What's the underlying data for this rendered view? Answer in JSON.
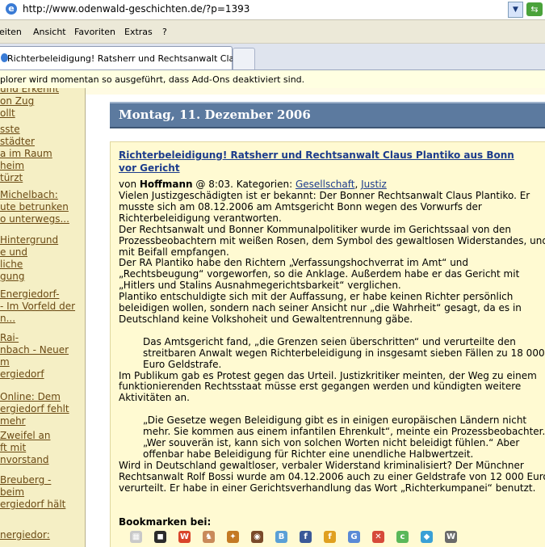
{
  "browser": {
    "address_url": "http://www.odenwald-geschichten.de/?p=1393",
    "menu": [
      "eiten",
      "Ansicht",
      "Favoriten",
      "Extras",
      "?"
    ],
    "tab_title": "Richterbeleidigung! Ratsherr und Rechtsanwalt Claus ...",
    "infobar_text": "plorer wird momentan so ausgeführt, dass Add-Ons deaktiviert sind."
  },
  "sidebar": {
    "items": [
      [
        "und Erkennt",
        "on Zug",
        "ollt"
      ],
      [
        "sste",
        "städter",
        "a im Raum",
        "heim",
        "türzt"
      ],
      [
        "Michelbach:",
        "ute betrunken",
        "o unterwegs..."
      ],
      [
        "Hintergrund",
        "e und",
        "liche",
        "gung"
      ],
      [
        "Energiedorf-",
        "- Im Vorfeld der",
        "n..."
      ],
      [
        "Rai-",
        "nbach - Neuer",
        "m",
        "ergiedorf"
      ],
      [
        "Online: Dem",
        "ergiedorf fehlt",
        "mehr"
      ],
      [
        "Zweifel an",
        "ft mit",
        "nvorstand"
      ],
      [
        "Breuberg -",
        "beim",
        "ergiedorf hält"
      ],
      [
        "nergiedor:"
      ]
    ]
  },
  "main": {
    "date_header": "Montag, 11. Dezember 2006",
    "post": {
      "title": "Richterbeleidigung! Ratsherr und Rechtsanwalt Claus Plantiko aus Bonn vor Gericht",
      "meta_prefix": "von ",
      "author": "Hoffmann",
      "meta_mid": " @ 8:03. Kategorien: ",
      "category_1": "Gesellschaft",
      "category_sep": ", ",
      "category_2": "Justiz",
      "paragraphs": [
        "Vielen Justizgeschädigten ist er bekannt: Der Bonner Rechtsanwalt Claus Plantiko. Er musste sich am 08.12.2006 am Amtsgericht Bonn wegen des Vorwurfs der Richterbeleidigung verantworten.",
        "Der Rechtsanwalt und Bonner Kommunalpolitiker wurde im Gerichtssaal von den Prozessbeobachtern mit weißen Rosen, dem Symbol des gewaltlosen Widerstandes, und mit Beifall empfangen.",
        "Der RA Plantiko habe den Richtern „Verfassungshochverrat im Amt“ und „Rechtsbeugung“ vorgeworfen, so die Anklage. Außerdem habe er das Gericht mit „Hitlers und Stalins Ausnahmegerichtsbarkeit“ verglichen.",
        "Plantiko entschuldigte sich mit der Auffassung, er habe keinen Richter persönlich beleidigen wollen, sondern nach seiner Ansicht nur „die Wahrheit“ gesagt, da es in Deutschland keine Volkshoheit und Gewaltentrennung gäbe.",
        "",
        "Das Amtsgericht fand, „die Grenzen seien überschritten“ und verurteilte den streitbaren Anwalt wegen Richterbeleidigung in insgesamt sieben Fällen zu 18 000 Euro Geldstrafe.",
        "Im Publikum gab es Protest gegen das Urteil. Justizkritiker meinten, der Weg zu einem funktionierenden Rechtsstaat müsse erst gegangen werden und kündigten weitere Aktivitäten an.",
        "",
        "„Die Gesetze wegen Beleidigung gibt es in einigen europäischen Ländern nicht mehr. Sie kommen aus einem infantilen Ehrenkult“, meinte ein Prozessbeobachter. „Wer souverän ist, kann sich von solchen Worten nicht beleidigt fühlen.“ Aber offenbar habe Beleidigung für Richter eine unendliche Halbwertzeit.",
        "Wird in Deutschland gewaltloser, verbaler Widerstand kriminalisiert? Der Münchner Rechtsanwalt Rolf Bossi wurde am 04.12.2006 auch zu einer Geldstrafe von 12 000 Euro verurteilt. Er habe in einer Gerichtsverhandlung das Wort „Richterkumpanei“ benutzt."
      ],
      "bookmarks_label": "Bookmarken bei:"
    }
  },
  "bookmark_icons": [
    {
      "name": "delicious-icon",
      "color": "#c9c9c9",
      "glyph": "▦"
    },
    {
      "name": "mrwong-icon",
      "color": "#2b2b2b",
      "glyph": "◼"
    },
    {
      "name": "webnews-icon",
      "color": "#d9442a",
      "glyph": "W"
    },
    {
      "name": "yigg-icon",
      "color": "#c98a5a",
      "glyph": "♞"
    },
    {
      "name": "folkd-icon",
      "color": "#c47a24",
      "glyph": "✦"
    },
    {
      "name": "linkarena-icon",
      "color": "#7a4a2a",
      "glyph": "◉"
    },
    {
      "name": "blinklist-icon",
      "color": "#5aa0d6",
      "glyph": "B"
    },
    {
      "name": "facebook-icon",
      "color": "#3b5998",
      "glyph": "f"
    },
    {
      "name": "favoriten-icon",
      "color": "#e0a020",
      "glyph": "f"
    },
    {
      "name": "google-icon",
      "color": "#5a8ad6",
      "glyph": "G"
    },
    {
      "name": "stumble-icon",
      "color": "#d64a3a",
      "glyph": "✕"
    },
    {
      "name": "twitter-icon",
      "color": "#5ab85a",
      "glyph": "c"
    },
    {
      "name": "diigo-icon",
      "color": "#3aa0d6",
      "glyph": "◆"
    },
    {
      "name": "wikio-icon",
      "color": "#6a6a6a",
      "glyph": "W"
    }
  ]
}
